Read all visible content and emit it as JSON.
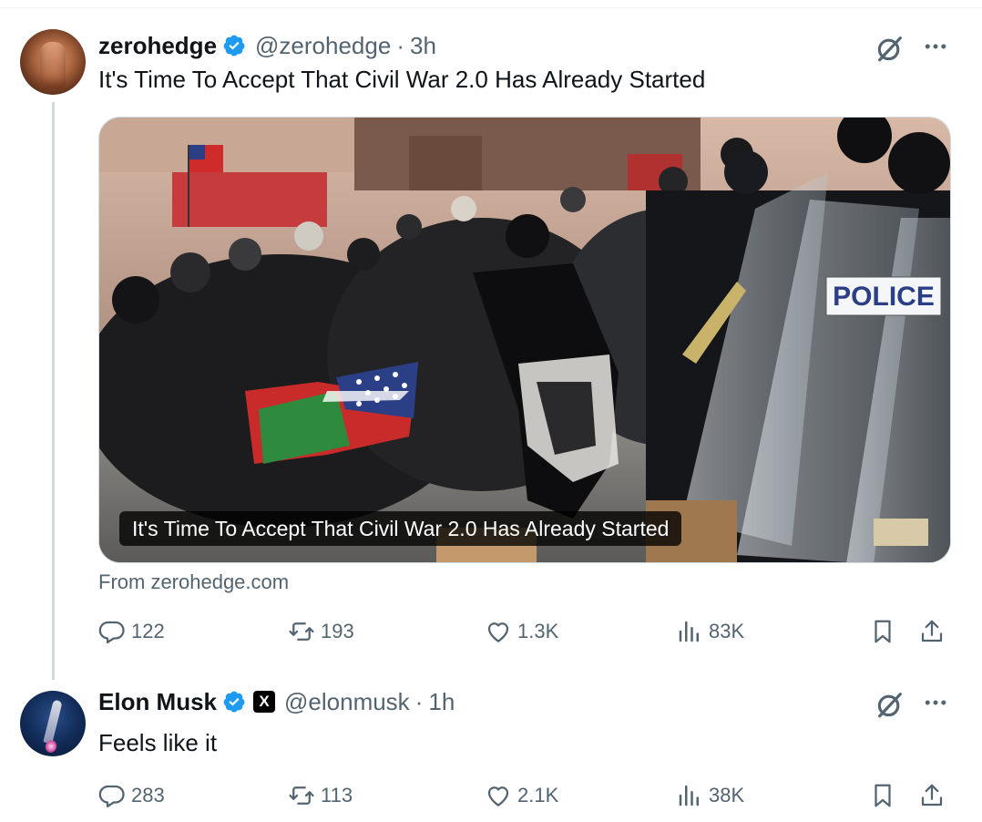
{
  "tweets": [
    {
      "author": {
        "name": "zerohedge",
        "handle": "@zerohedge",
        "verified": true
      },
      "separator": "·",
      "time": "3h",
      "text": "It's Time To Accept That Civil War 2.0 Has Already Started",
      "card": {
        "caption": "It's Time To Accept That Civil War 2.0 Has Already Started",
        "source": "From zerohedge.com",
        "image_sign_text": "POLICE"
      },
      "stats": {
        "replies": "122",
        "retweets": "193",
        "likes": "1.3K",
        "views": "83K"
      }
    },
    {
      "author": {
        "name": "Elon Musk",
        "handle": "@elonmusk",
        "verified": true,
        "affiliate_badge": "X"
      },
      "separator": "·",
      "time": "1h",
      "text": "Feels like it",
      "stats": {
        "replies": "283",
        "retweets": "113",
        "likes": "2.1K",
        "views": "38K"
      }
    }
  ],
  "icons": {
    "reply": "reply-icon",
    "retweet": "retweet-icon",
    "like": "like-icon",
    "views": "views-icon",
    "bookmark": "bookmark-icon",
    "share": "share-icon",
    "grok": "grok-icon",
    "more": "more-icon",
    "verified": "verified-badge-icon"
  },
  "colors": {
    "verified_blue": "#1d9bf0",
    "text_primary": "#0f1419",
    "text_secondary": "#536471",
    "border": "#cfd9de"
  }
}
